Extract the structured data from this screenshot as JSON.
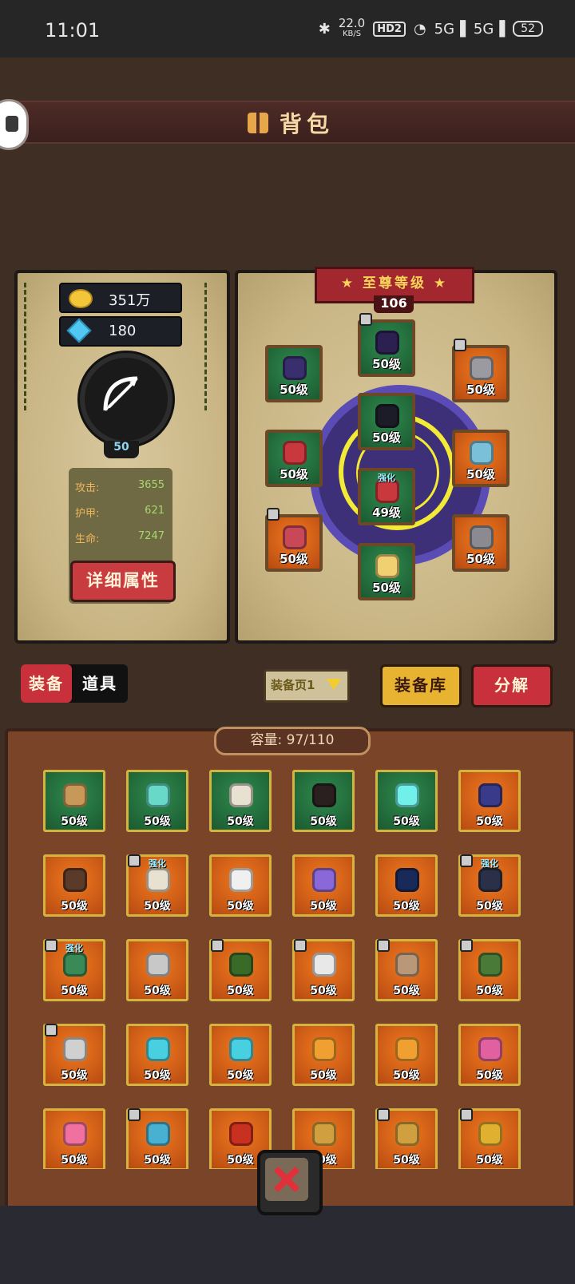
{
  "status_bar": {
    "time": "11:01",
    "speed": "22.0",
    "speed_unit": "KB/S",
    "hd": "HD2",
    "signal1": "5G",
    "signal2": "5G",
    "battery": "52"
  },
  "title": "背包",
  "resources": {
    "gold": "351万",
    "gems": "180"
  },
  "hero": {
    "level": "50",
    "stats": [
      {
        "label": "攻击:",
        "value": "3655"
      },
      {
        "label": "护甲:",
        "value": "621"
      },
      {
        "label": "生命:",
        "value": "7247"
      }
    ],
    "detail_button": "详细属性"
  },
  "rank": {
    "title": "至尊等级",
    "level": "106"
  },
  "equipped": [
    {
      "level": "50级",
      "color": "green",
      "gear": "#3a2f6e",
      "locked": false,
      "tag": ""
    },
    {
      "level": "50级",
      "color": "green",
      "gear": "#2b2050",
      "locked": true,
      "tag": ""
    },
    {
      "level": "50级",
      "color": "orange",
      "gear": "#9a9aa0",
      "locked": true,
      "tag": ""
    },
    {
      "level": "50级",
      "color": "green",
      "gear": "#1c1c28",
      "locked": false,
      "tag": ""
    },
    {
      "level": "50级",
      "color": "green",
      "gear": "#c8383c",
      "locked": false,
      "tag": ""
    },
    {
      "level": "49级",
      "color": "green",
      "gear": "#c8383c",
      "locked": false,
      "tag": "强化"
    },
    {
      "level": "50级",
      "color": "orange",
      "gear": "#7ac0d8",
      "locked": false,
      "tag": ""
    },
    {
      "level": "50级",
      "color": "orange",
      "gear": "#c84858",
      "locked": true,
      "tag": ""
    },
    {
      "level": "50级",
      "color": "orange",
      "gear": "#8a8a90",
      "locked": false,
      "tag": ""
    },
    {
      "level": "50级",
      "color": "green",
      "gear": "#f0d070",
      "locked": false,
      "tag": ""
    }
  ],
  "tabs": {
    "equip": "装备",
    "items": "道具"
  },
  "page_select": "装备页1",
  "vault_button": "装备库",
  "decompose_button": "分解",
  "capacity": "容量: 97/110",
  "inventory": [
    {
      "level": "50级",
      "color": "green",
      "gear": "#c89858",
      "locked": false,
      "tag": ""
    },
    {
      "level": "50级",
      "color": "green",
      "gear": "#68d8c8",
      "locked": false,
      "tag": ""
    },
    {
      "level": "50级",
      "color": "green",
      "gear": "#e8e0d0",
      "locked": false,
      "tag": ""
    },
    {
      "level": "50级",
      "color": "green",
      "gear": "#2a2020",
      "locked": false,
      "tag": ""
    },
    {
      "level": "50级",
      "color": "green",
      "gear": "#70f0e8",
      "locked": false,
      "tag": ""
    },
    {
      "level": "50级",
      "color": "orange",
      "gear": "#3a3a8a",
      "locked": false,
      "tag": ""
    },
    {
      "level": "50级",
      "color": "orange",
      "gear": "#5a3a28",
      "locked": false,
      "tag": ""
    },
    {
      "level": "50级",
      "color": "orange",
      "gear": "#e8e0d0",
      "locked": true,
      "tag": "强化"
    },
    {
      "level": "50级",
      "color": "orange",
      "gear": "#f0f0f0",
      "locked": false,
      "tag": ""
    },
    {
      "level": "50级",
      "color": "orange",
      "gear": "#8a68d8",
      "locked": false,
      "tag": ""
    },
    {
      "level": "50级",
      "color": "orange",
      "gear": "#1a2a58",
      "locked": false,
      "tag": ""
    },
    {
      "level": "50级",
      "color": "orange",
      "gear": "#2a3048",
      "locked": true,
      "tag": "强化"
    },
    {
      "level": "50级",
      "color": "orange",
      "gear": "#3a8a58",
      "locked": true,
      "tag": "强化"
    },
    {
      "level": "50级",
      "color": "orange",
      "gear": "#c8c8c8",
      "locked": false,
      "tag": ""
    },
    {
      "level": "50级",
      "color": "orange",
      "gear": "#3a6a28",
      "locked": true,
      "tag": ""
    },
    {
      "level": "50级",
      "color": "orange",
      "gear": "#e8e8e8",
      "locked": true,
      "tag": ""
    },
    {
      "level": "50级",
      "color": "orange",
      "gear": "#b89878",
      "locked": true,
      "tag": ""
    },
    {
      "level": "50级",
      "color": "orange",
      "gear": "#4a7a38",
      "locked": true,
      "tag": ""
    },
    {
      "level": "50级",
      "color": "orange",
      "gear": "#d0d0d0",
      "locked": true,
      "tag": ""
    },
    {
      "level": "50级",
      "color": "orange",
      "gear": "#48d0e0",
      "locked": false,
      "tag": ""
    },
    {
      "level": "50级",
      "color": "orange",
      "gear": "#48d0e0",
      "locked": false,
      "tag": ""
    },
    {
      "level": "50级",
      "color": "orange",
      "gear": "#f0a030",
      "locked": false,
      "tag": ""
    },
    {
      "level": "50级",
      "color": "orange",
      "gear": "#f0a030",
      "locked": false,
      "tag": ""
    },
    {
      "level": "50级",
      "color": "orange",
      "gear": "#e060a0",
      "locked": false,
      "tag": ""
    },
    {
      "level": "50级",
      "color": "orange",
      "gear": "#f070a0",
      "locked": false,
      "tag": ""
    },
    {
      "level": "50级",
      "color": "orange",
      "gear": "#48b0d0",
      "locked": true,
      "tag": ""
    },
    {
      "level": "50级",
      "color": "orange",
      "gear": "#c83020",
      "locked": false,
      "tag": ""
    },
    {
      "level": "50级",
      "color": "orange",
      "gear": "#d0a040",
      "locked": false,
      "tag": ""
    },
    {
      "level": "50级",
      "color": "orange",
      "gear": "#d0a040",
      "locked": true,
      "tag": ""
    },
    {
      "level": "50级",
      "color": "orange",
      "gear": "#e0b030",
      "locked": true,
      "tag": ""
    }
  ]
}
